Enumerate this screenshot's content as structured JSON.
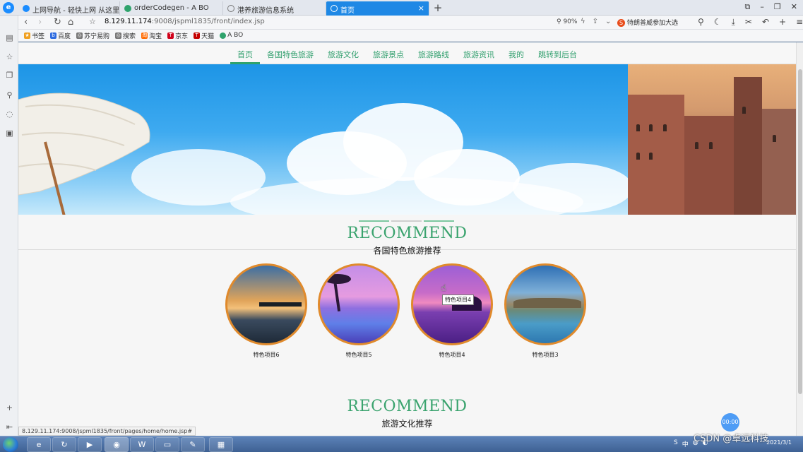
{
  "browser": {
    "tabs": [
      {
        "title": "上网导航 - 轻快上网 从这里开始",
        "icon_color": "#1a8cff",
        "active": false
      },
      {
        "title": "orderCodegen - A BO",
        "icon_color": "#2fa36c",
        "active": false
      },
      {
        "title": "港养旅游信息系统",
        "icon_color": "#777777",
        "active": false
      },
      {
        "title": "首页",
        "icon_color": "#ffffff",
        "active": true
      }
    ],
    "new_tab": "+",
    "window_controls": [
      "⧉",
      "–",
      "❐",
      "✕"
    ],
    "url_host": "8.129.11.174",
    "url_path": ":9008/jspml1835/front/index.jsp",
    "zoom": "90%",
    "promo_text": "特朗普威参加大选",
    "bookmarks": [
      {
        "label": "书签",
        "color": "#f0a020"
      },
      {
        "label": "百度",
        "color": "#2d6be0"
      },
      {
        "label": "苏宁易购",
        "color": "#777777"
      },
      {
        "label": "搜索",
        "color": "#777777"
      },
      {
        "label": "淘宝",
        "color": "#ff6a00"
      },
      {
        "label": "京东",
        "color": "#d0021b"
      },
      {
        "label": "天猫",
        "color": "#c40000"
      },
      {
        "label": "A BO",
        "color": "#2fa36c"
      }
    ],
    "status_url": "8.129.11.174:9008/jspml1835/front/pages/home/home.jsp#"
  },
  "site": {
    "nav": [
      {
        "label": "首页",
        "active": true
      },
      {
        "label": "各国特色旅游",
        "active": false
      },
      {
        "label": "旅游文化",
        "active": false
      },
      {
        "label": "旅游景点",
        "active": false
      },
      {
        "label": "旅游路线",
        "active": false
      },
      {
        "label": "旅游资讯",
        "active": false
      },
      {
        "label": "我的",
        "active": false
      },
      {
        "label": "跳转到后台",
        "active": false
      }
    ],
    "section1": {
      "title": "RECOMMEND",
      "subtitle": "各国特色旅游推荐",
      "items": [
        {
          "label": "特色项目6"
        },
        {
          "label": "特色项目5"
        },
        {
          "label": "特色项目4"
        },
        {
          "label": "特色项目3"
        }
      ],
      "tooltip": "特色项目4"
    },
    "section2": {
      "title": "RECOMMEND",
      "subtitle": "旅游文化推荐"
    },
    "accent_color": "#3aa36e",
    "border_color": "#e08a2c"
  },
  "overlay": {
    "timer": "00:00",
    "watermark": "CSDN @卓远科技",
    "clock_date": "2021/3/1",
    "tray_ime": "中"
  }
}
